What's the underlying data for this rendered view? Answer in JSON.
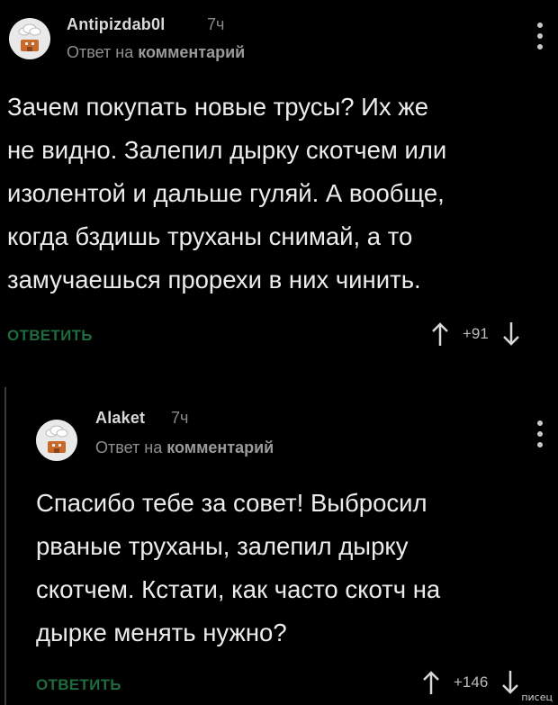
{
  "comments": [
    {
      "author": "Antipizdab0l",
      "time": "7ч",
      "reply_prefix": "Ответ на",
      "reply_link": "комментарий",
      "lines": [
        "Зачем покупать новые трусы? Их же",
        "не видно. Залепил дырку скотчем или",
        "изолентой и дальше гуляй. А вообще,",
        "когда бздишь труханы снимай, а то",
        "замучаешься прорехи в них чинить."
      ],
      "reply_button": "ОТВЕТИТЬ",
      "score": "+91"
    },
    {
      "author": "Alaket",
      "time": "7ч",
      "reply_prefix": "Ответ на",
      "reply_link": "комментарий",
      "lines": [
        "Спасибо тебе за совет! Выбросил",
        "рваные труханы, залепил дырку",
        "скотчем. Кстати, как часто скотч на",
        "дырке менять нужно?"
      ],
      "reply_button": "ОТВЕТИТЬ",
      "score": "+146"
    }
  ],
  "watermark": "писец",
  "colors": {
    "background": "#000000",
    "text": "#ececec",
    "meta": "#8f8f8f",
    "reply_green": "#1f6b3d",
    "avatar_bg": "#e9e9e9",
    "avatar_brown": "#c96a2a"
  },
  "icons": {
    "avatar": "default-avatar-icon",
    "menu": "more-vertical-icon",
    "upvote": "arrow-up-icon",
    "downvote": "arrow-down-icon"
  }
}
